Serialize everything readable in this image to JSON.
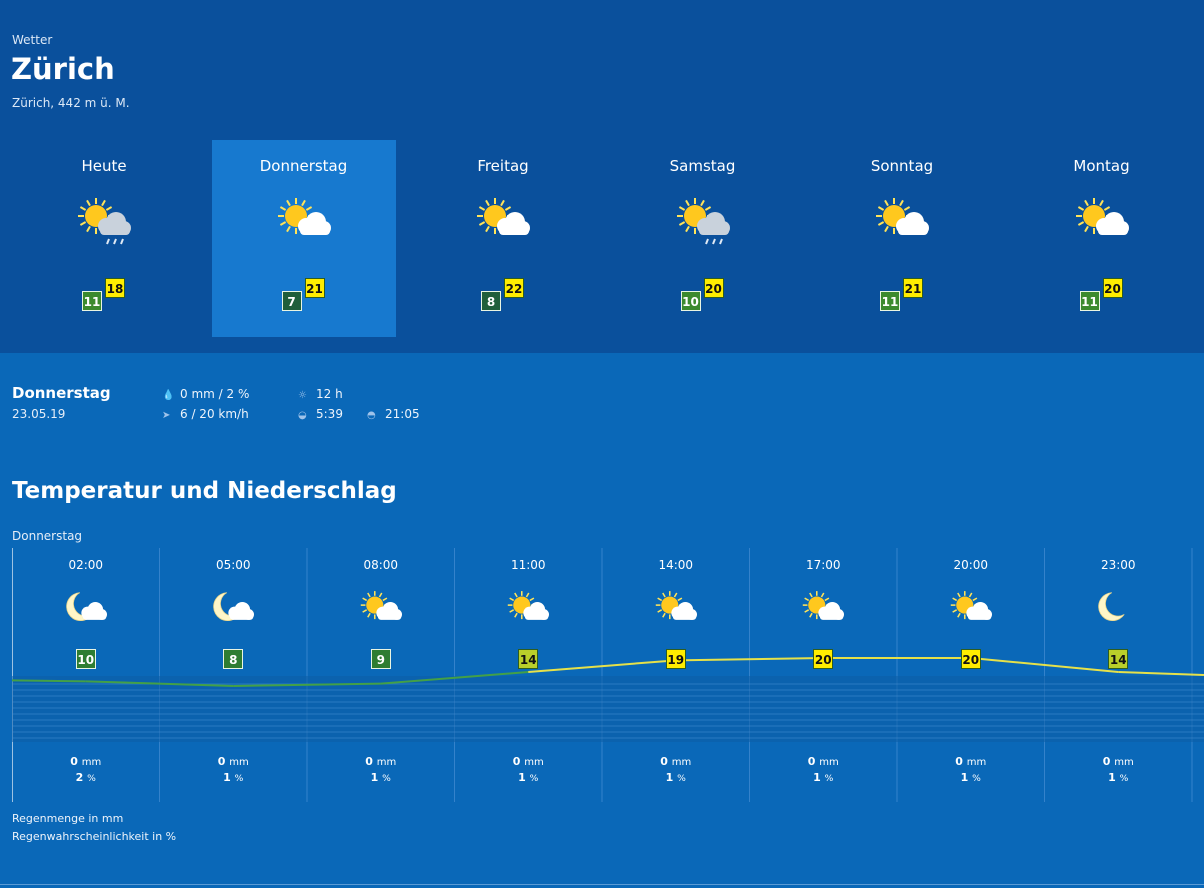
{
  "header": {
    "section_label": "Wetter",
    "city": "Zürich",
    "altitude": "Zürich, 442 m ü. M."
  },
  "days": [
    {
      "name": "Heute",
      "icon": "sun-cloud-rain-icon",
      "min": "11",
      "max": "18",
      "selected": false
    },
    {
      "name": "Donnerstag",
      "icon": "sun-cloud-icon",
      "min": "7",
      "max": "21",
      "selected": true
    },
    {
      "name": "Freitag",
      "icon": "sun-cloud-icon",
      "min": "8",
      "max": "22",
      "selected": false
    },
    {
      "name": "Samstag",
      "icon": "sun-cloud-rain-icon",
      "min": "10",
      "max": "20",
      "selected": false
    },
    {
      "name": "Sonntag",
      "icon": "sun-cloud-icon",
      "min": "11",
      "max": "21",
      "selected": false
    },
    {
      "name": "Montag",
      "icon": "sun-cloud-icon",
      "min": "11",
      "max": "20",
      "selected": false
    }
  ],
  "detail": {
    "day": "Donnerstag",
    "date": "23.05.19",
    "precip": "0 mm / 2 %",
    "wind": "6 / 20 km/h",
    "sun_hours": "12 h",
    "sunrise": "5:39",
    "sunset": "21:05"
  },
  "section_title": "Temperatur und Niederschlag",
  "chart_day": "Donnerstag",
  "chart_data": {
    "type": "line",
    "x": [
      "02:00",
      "05:00",
      "08:00",
      "11:00",
      "14:00",
      "17:00",
      "20:00",
      "23:00"
    ],
    "series": [
      {
        "values": [
          10,
          8,
          9,
          14,
          19,
          20,
          20,
          14
        ]
      }
    ],
    "icons": [
      "moon-cloud-icon",
      "moon-cloud-icon",
      "sun-cloud-icon",
      "sun-cloud-icon",
      "sun-cloud-icon",
      "sun-cloud-icon",
      "sun-cloud-icon",
      "moon-icon"
    ],
    "rain_mm": [
      "0",
      "0",
      "0",
      "0",
      "0",
      "0",
      "0",
      "0"
    ],
    "rain_unit": "mm",
    "rain_prob": [
      "2",
      "1",
      "1",
      "1",
      "1",
      "1",
      "1",
      "1"
    ],
    "prob_unit": "%",
    "grid": true
  },
  "legend": {
    "rain_amount": "Regenmenge in mm",
    "rain_prob": "Regenwahrscheinlichkeit in %"
  },
  "colors": {
    "header_bg": "#0a509c",
    "body_bg": "#0a68b8",
    "selected_bg": "#1779cf",
    "max_temp": "#ffed00",
    "line_warm": "#e6e14a",
    "line_cool": "#43a047"
  }
}
